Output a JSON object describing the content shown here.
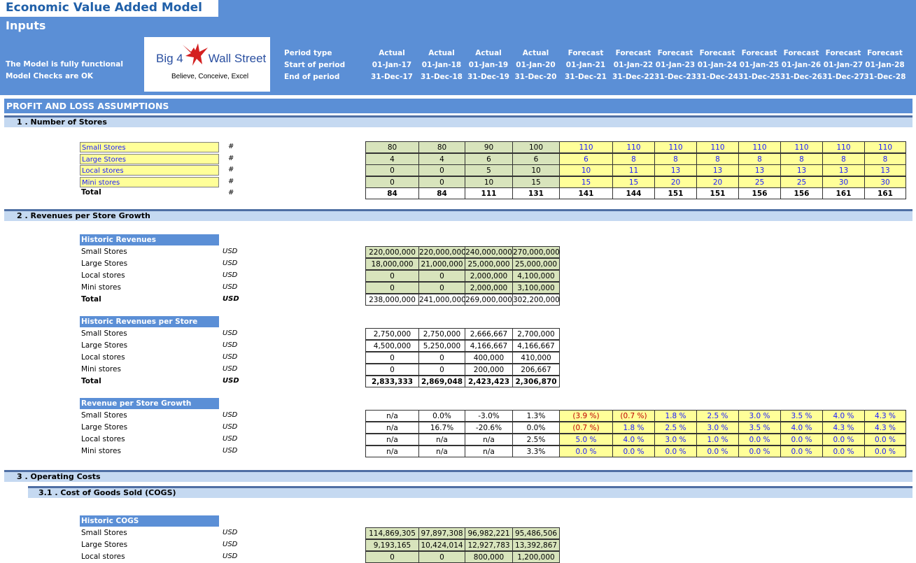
{
  "title": "Economic Value Added Model",
  "section_inputs": "Inputs",
  "status1": "The Model is fully functional",
  "status2": "Model Checks are OK",
  "logo": {
    "text_left": "Big 4",
    "text_right": "Wall Street",
    "tagline": "Believe, Conceive, Excel"
  },
  "header_labels": [
    "Period type",
    "Start of period",
    "End of period"
  ],
  "periods": [
    {
      "type": "Actual",
      "start": "01-Jan-17",
      "end": "31-Dec-17"
    },
    {
      "type": "Actual",
      "start": "01-Jan-18",
      "end": "31-Dec-18"
    },
    {
      "type": "Actual",
      "start": "01-Jan-19",
      "end": "31-Dec-19"
    },
    {
      "type": "Actual",
      "start": "01-Jan-20",
      "end": "31-Dec-20"
    },
    {
      "type": "Forecast",
      "start": "01-Jan-21",
      "end": "31-Dec-21"
    },
    {
      "type": "Forecast",
      "start": "01-Jan-22",
      "end": "31-Dec-22"
    },
    {
      "type": "Forecast",
      "start": "01-Jan-23",
      "end": "31-Dec-23"
    },
    {
      "type": "Forecast",
      "start": "01-Jan-24",
      "end": "31-Dec-24"
    },
    {
      "type": "Forecast",
      "start": "01-Jan-25",
      "end": "31-Dec-25"
    },
    {
      "type": "Forecast",
      "start": "01-Jan-26",
      "end": "31-Dec-26"
    },
    {
      "type": "Forecast",
      "start": "01-Jan-27",
      "end": "31-Dec-27"
    },
    {
      "type": "Forecast",
      "start": "01-Jan-28",
      "end": "31-Dec-28"
    }
  ],
  "pl_section": "PROFIT AND LOSS ASSUMPTIONS",
  "s1": "1 .  Number of Stores",
  "s2": "2 .  Revenues per Store Growth",
  "s3": "3 .  Operating Costs",
  "s31": "3.1 .  Cost of Goods Sold (COGS)",
  "stores": {
    "unit": "#",
    "rows": [
      {
        "label": "Small Stores",
        "values": [
          "80",
          "80",
          "90",
          "100",
          "110",
          "110",
          "110",
          "110",
          "110",
          "110",
          "110",
          "110"
        ]
      },
      {
        "label": "Large Stores",
        "values": [
          "4",
          "4",
          "6",
          "6",
          "6",
          "8",
          "8",
          "8",
          "8",
          "8",
          "8",
          "8"
        ]
      },
      {
        "label": "Local stores",
        "values": [
          "0",
          "0",
          "5",
          "10",
          "10",
          "11",
          "13",
          "13",
          "13",
          "13",
          "13",
          "13"
        ]
      },
      {
        "label": "Mini stores",
        "values": [
          "0",
          "0",
          "10",
          "15",
          "15",
          "15",
          "20",
          "20",
          "25",
          "25",
          "30",
          "30"
        ]
      }
    ],
    "total": {
      "label": "Total",
      "values": [
        "84",
        "84",
        "111",
        "131",
        "141",
        "144",
        "151",
        "151",
        "156",
        "156",
        "161",
        "161"
      ]
    }
  },
  "hist_rev": {
    "title": "Historic Revenues",
    "unit": "USD",
    "rows": [
      {
        "label": "Small Stores",
        "values": [
          "220,000,000",
          "220,000,000",
          "240,000,000",
          "270,000,000"
        ]
      },
      {
        "label": "Large Stores",
        "values": [
          "18,000,000",
          "21,000,000",
          "25,000,000",
          "25,000,000"
        ]
      },
      {
        "label": "Local stores",
        "values": [
          "0",
          "0",
          "2,000,000",
          "4,100,000"
        ]
      },
      {
        "label": "Mini stores",
        "values": [
          "0",
          "0",
          "2,000,000",
          "3,100,000"
        ]
      }
    ],
    "total": {
      "label": "Total",
      "values": [
        "238,000,000",
        "241,000,000",
        "269,000,000",
        "302,200,000"
      ]
    }
  },
  "hist_rev_store": {
    "title": "Historic Revenues per Store",
    "unit": "USD",
    "rows": [
      {
        "label": "Small Stores",
        "values": [
          "2,750,000",
          "2,750,000",
          "2,666,667",
          "2,700,000"
        ]
      },
      {
        "label": "Large Stores",
        "values": [
          "4,500,000",
          "5,250,000",
          "4,166,667",
          "4,166,667"
        ]
      },
      {
        "label": "Local stores",
        "values": [
          "0",
          "0",
          "400,000",
          "410,000"
        ]
      },
      {
        "label": "Mini stores",
        "values": [
          "0",
          "0",
          "200,000",
          "206,667"
        ]
      }
    ],
    "total": {
      "label": "Total",
      "values": [
        "2,833,333",
        "2,869,048",
        "2,423,423",
        "2,306,870"
      ]
    }
  },
  "growth": {
    "title": "Revenue per Store Growth",
    "unit": "USD",
    "rows": [
      {
        "label": "Small Stores",
        "values": [
          "n/a",
          "0.0%",
          "-3.0%",
          "1.3%",
          "(3.9 %)",
          "(0.7 %)",
          "1.8 %",
          "2.5 %",
          "3.0 %",
          "3.5 %",
          "4.0 %",
          "4.3 %"
        ]
      },
      {
        "label": "Large Stores",
        "values": [
          "n/a",
          "16.7%",
          "-20.6%",
          "0.0%",
          "(0.7 %)",
          "1.8 %",
          "2.5 %",
          "3.0 %",
          "3.5 %",
          "4.0 %",
          "4.3 %",
          "4.3 %"
        ]
      },
      {
        "label": "Local stores",
        "values": [
          "n/a",
          "n/a",
          "n/a",
          "2.5%",
          "5.0 %",
          "4.0 %",
          "3.0 %",
          "1.0 %",
          "0.0 %",
          "0.0 %",
          "0.0 %",
          "0.0 %"
        ]
      },
      {
        "label": "Mini stores",
        "values": [
          "n/a",
          "n/a",
          "n/a",
          "3.3%",
          "0.0 %",
          "0.0 %",
          "0.0 %",
          "0.0 %",
          "0.0 %",
          "0.0 %",
          "0.0 %",
          "0.0 %"
        ]
      }
    ]
  },
  "cogs": {
    "title": "Historic COGS",
    "unit": "USD",
    "rows": [
      {
        "label": "Small Stores",
        "values": [
          "114,869,305",
          "97,897,308",
          "96,982,221",
          "95,486,506"
        ]
      },
      {
        "label": "Large Stores",
        "values": [
          "9,193,165",
          "10,424,014",
          "12,927,783",
          "13,392,867"
        ]
      },
      {
        "label": "Local stores",
        "values": [
          "0",
          "0",
          "800,000",
          "1,200,000"
        ]
      }
    ]
  },
  "colors": {
    "band": "#5b8fd6",
    "sub": "#c5d9f1",
    "green": "#d8e4bc",
    "yellow": "#ffff99",
    "input_blue": "#1a1aff",
    "negative": "#c00000"
  }
}
